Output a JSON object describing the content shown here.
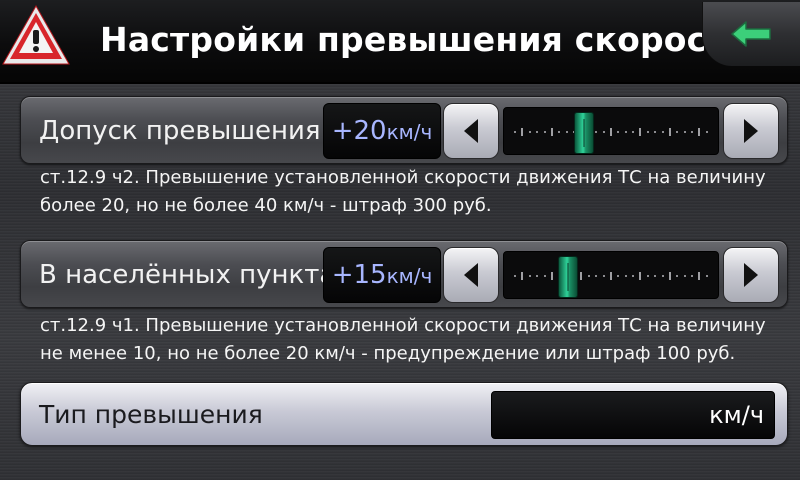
{
  "header": {
    "title": "Настройки превышения скорости",
    "warning_icon": "warning-triangle-icon",
    "back_icon": "back-arrow-icon",
    "back_icon_color": "#3ccf7a"
  },
  "settings": [
    {
      "label": "Допуск превышения:",
      "value": "+20",
      "unit": "км/ч",
      "slider_fraction": 0.35,
      "description": "ст.12.9 ч2. Превышение установленной скорости движения ТС на величину более 20, но не более 40 км/ч - штраф 300 руб."
    },
    {
      "label": "В населённых пунктах:",
      "value": "+15",
      "unit": "км/ч",
      "slider_fraction": 0.26,
      "description": "ст.12.9 ч1. Превышение установленной скорости движения ТС на величину не менее 10, но не более 20 км/ч - предупреждение или штраф 100 руб."
    }
  ],
  "type_row": {
    "label": "Тип превышения",
    "value": "км/ч"
  },
  "colors": {
    "value_text": "#a8b6ff",
    "slider_thumb": "#2fd39a",
    "warning_red": "#d8262b"
  }
}
